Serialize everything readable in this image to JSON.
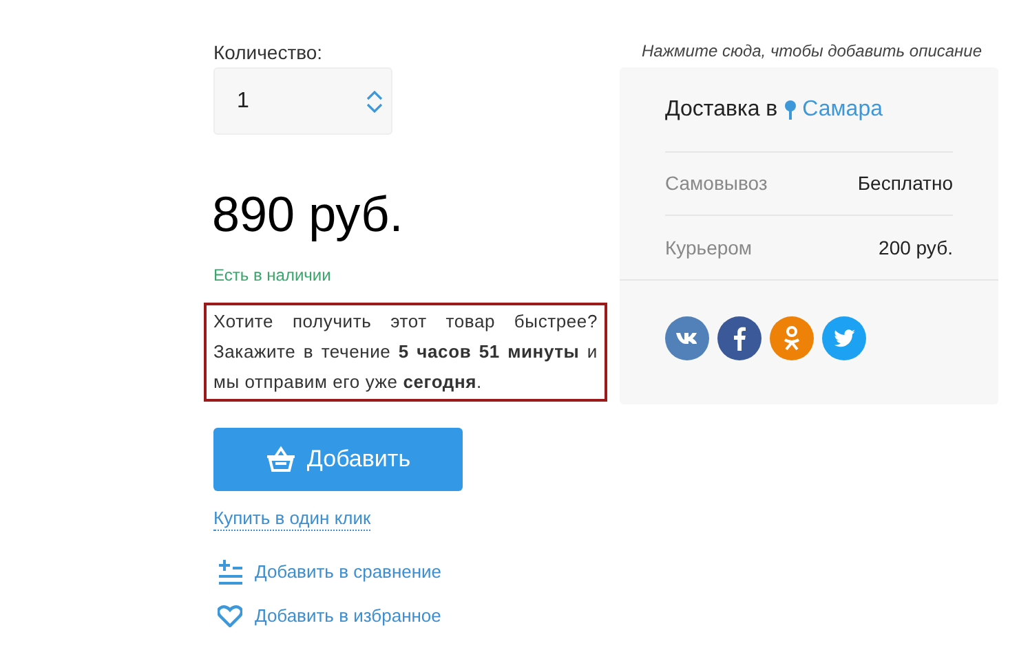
{
  "quantity": {
    "label": "Количество:",
    "value": "1"
  },
  "price": "890 руб.",
  "stock": "Есть в наличии",
  "promo": "Хотите получить этот товар быстрее? Закажите в течение **5 часов 51 минуты** и мы отправим его уже **сегодня**.",
  "add_button": "Добавить",
  "one_click": "Купить в один клик",
  "actions": [
    {
      "kind": "compare",
      "label": "Добавить в сравнение"
    },
    {
      "kind": "favorite",
      "label": "Добавить в избранное"
    }
  ],
  "description_hint": "Нажмите сюда, чтобы добавить описание",
  "delivery": {
    "title": "Доставка в",
    "city": "Самара",
    "rows": [
      {
        "method": "Самовывоз",
        "cost": "Бесплатно"
      },
      {
        "method": "Курьером",
        "cost": "200 руб."
      }
    ]
  },
  "social": [
    {
      "kind": "vk"
    },
    {
      "kind": "facebook"
    },
    {
      "kind": "ok"
    },
    {
      "kind": "twitter"
    }
  ]
}
